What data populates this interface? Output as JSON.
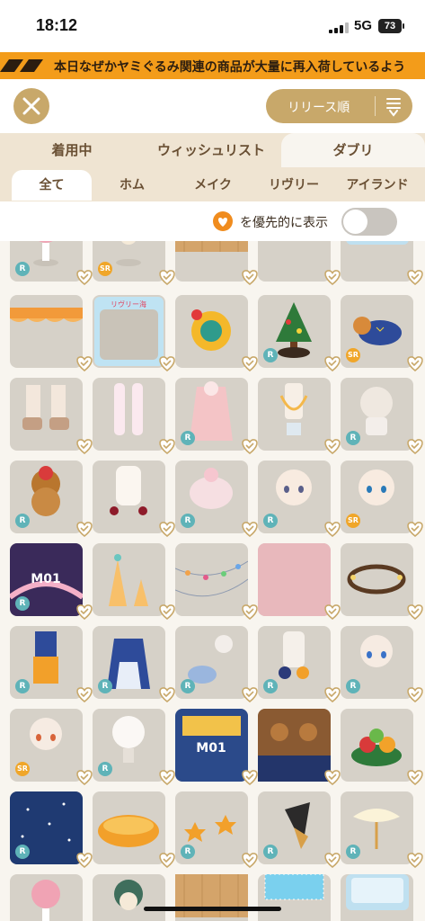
{
  "status_bar": {
    "time": "18:12",
    "network": "5G",
    "battery": "73"
  },
  "ticker": {
    "text": "本日なぜかヤミぐるみ関連の商品が大量に再入荷しているよう"
  },
  "toolbar": {
    "sort_label": "リリース順"
  },
  "tabs_primary": {
    "items": [
      {
        "label": "着用中"
      },
      {
        "label": "ウィッシュリスト"
      },
      {
        "label": "ダブリ"
      }
    ],
    "active": "ダブリ"
  },
  "tabs_secondary": {
    "items": [
      {
        "label": "全て"
      },
      {
        "label": "ホム"
      },
      {
        "label": "メイク"
      },
      {
        "label": "リヴリー"
      },
      {
        "label": "アイランド"
      }
    ],
    "active": "全て"
  },
  "filter": {
    "label": "を優先的に表示",
    "toggle_on": false
  },
  "item_rarities": [
    "R",
    "SR",
    "",
    "",
    "",
    "",
    "",
    "",
    "R",
    "SR",
    "",
    "",
    "R",
    "",
    "R",
    "R",
    "",
    "R",
    "R",
    "SR",
    "R",
    "",
    "",
    "",
    "",
    "R",
    "R",
    "R",
    "R",
    "R",
    "SR",
    "R",
    "",
    "",
    "",
    "R",
    "",
    "R",
    "R",
    "R"
  ],
  "thumb_labels": {
    "frame_title": "リヴリー海",
    "tag_code": "M01"
  },
  "colors": {
    "accent": "#c8a86a",
    "ticker": "#f39c1a",
    "rarity_r": "#5fb3b8",
    "rarity_sr": "#f0a629",
    "heart": "#f08c1e"
  }
}
